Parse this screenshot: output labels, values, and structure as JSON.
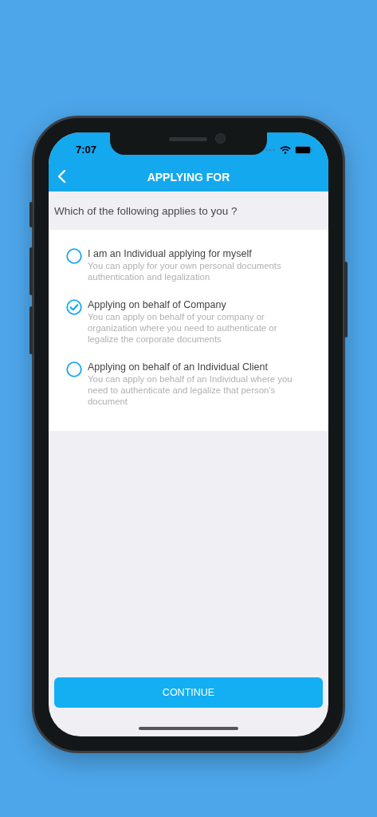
{
  "status_bar": {
    "time": "7:07"
  },
  "nav_bar": {
    "title": "APPLYING FOR"
  },
  "question": "Which of the following applies to you ?",
  "options": [
    {
      "title": "I am an Individual applying for myself",
      "description": "You can apply for your own personal documents authentication and legalization",
      "selected": false
    },
    {
      "title": "Applying on behalf of Company",
      "description": "You can apply on behalf of your company or organization where you need to authenticate or legalize the corporate documents",
      "selected": true
    },
    {
      "title": "Applying on behalf of an Individual Client",
      "description": "You can apply on behalf of an Individual where you need to authenticate and legalize that person's document",
      "selected": false
    }
  ],
  "button": {
    "label": "CONTINUE"
  }
}
